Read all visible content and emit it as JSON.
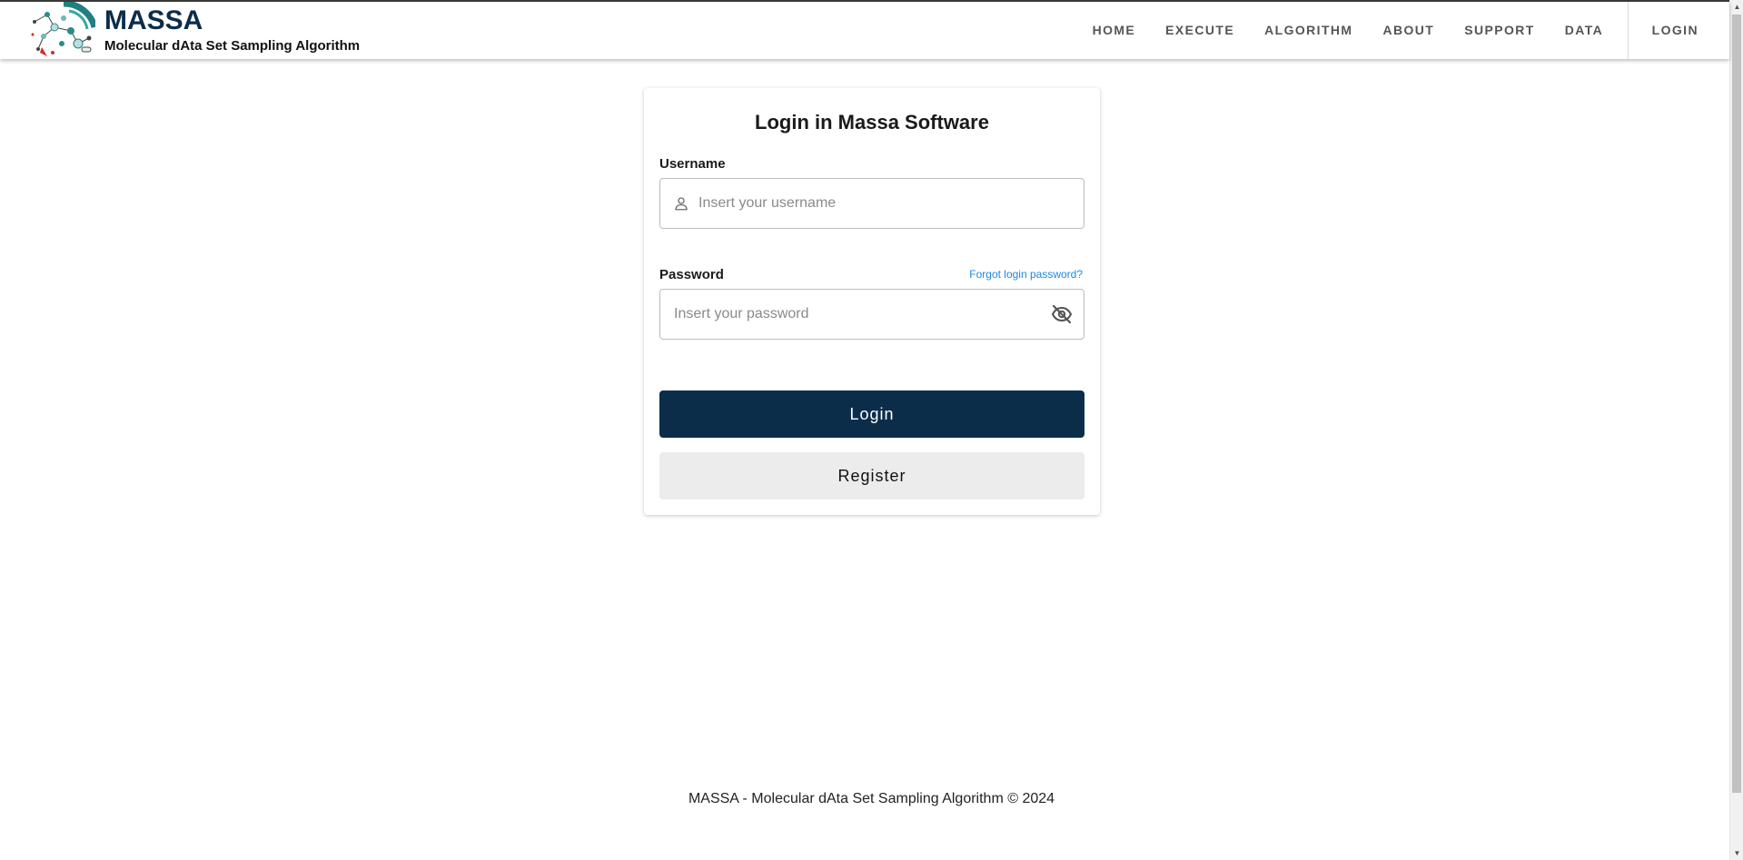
{
  "brand": {
    "title": "MASSA",
    "subtitle": "Molecular dAta Set Sampling Algorithm",
    "logo_icon": "molecular-logo-icon"
  },
  "nav": {
    "items": [
      {
        "label": "HOME"
      },
      {
        "label": "EXECUTE"
      },
      {
        "label": "ALGORITHM"
      },
      {
        "label": "ABOUT"
      },
      {
        "label": "SUPPORT"
      },
      {
        "label": "DATA"
      }
    ],
    "login_label": "LOGIN"
  },
  "login_card": {
    "title": "Login in Massa Software",
    "username": {
      "label": "Username",
      "placeholder": "Insert your username",
      "value": "",
      "icon": "user-icon"
    },
    "password": {
      "label": "Password",
      "placeholder": "Insert your password",
      "value": "",
      "forgot_label": "Forgot login password?",
      "icon": "eye-off-icon"
    },
    "login_button": "Login",
    "register_button": "Register"
  },
  "footer": {
    "text": "MASSA - Molecular dAta Set Sampling Algorithm © 2024"
  },
  "colors": {
    "primary": "#0b2d4a",
    "link": "#1e88e5",
    "secondary_button": "#ececec"
  }
}
